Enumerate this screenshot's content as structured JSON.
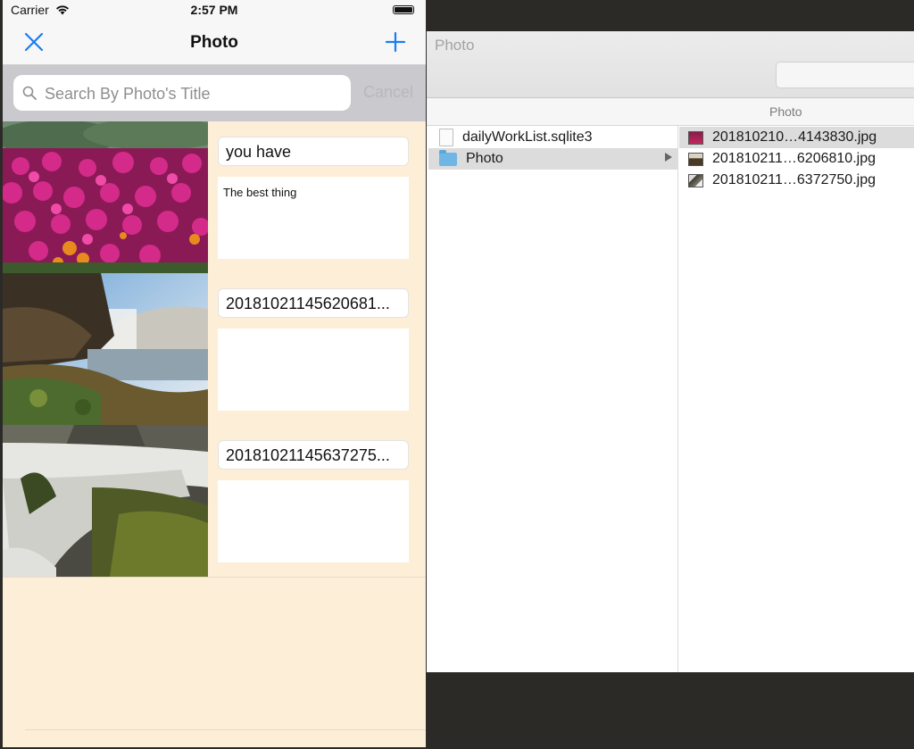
{
  "finder": {
    "title": "Photo",
    "column_header": "Photo",
    "items": [
      {
        "name": "dailyWorkList.sqlite3",
        "type": "file"
      },
      {
        "name": "Photo",
        "type": "folder",
        "selected": true
      }
    ],
    "photo_files": [
      {
        "name": "201810210…4143830.jpg",
        "selected": true
      },
      {
        "name": "201810211…6206810.jpg"
      },
      {
        "name": "201810211…6372750.jpg"
      }
    ]
  },
  "status_bar": {
    "carrier": "Carrier",
    "time": "2:57 PM"
  },
  "nav": {
    "title": "Photo",
    "left_icon": "close-icon",
    "right_icon": "add-icon",
    "tint_color": "#1a7cf5"
  },
  "search": {
    "placeholder": "Search By Photo's Title",
    "value": "",
    "cancel_label": "Cancel"
  },
  "photos": [
    {
      "title": "you have",
      "description": "The best thing",
      "image": "pink-flower-field"
    },
    {
      "title": "20181021145620681...",
      "description": "",
      "image": "waterfall-cliff"
    },
    {
      "title": "20181021145637275...",
      "description": "",
      "image": "mossy-waterfall"
    }
  ],
  "colors": {
    "background": "#fdeed8",
    "search_bar": "#c9c9ce"
  }
}
